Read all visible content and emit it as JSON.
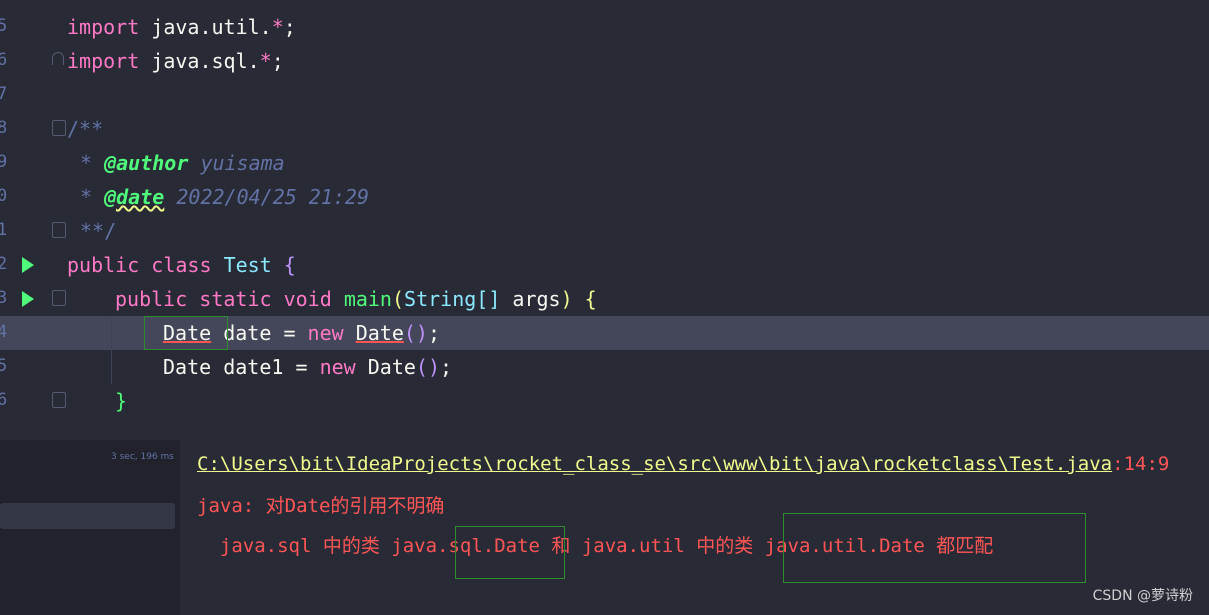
{
  "editor": {
    "lines": [
      {
        "num": "5"
      },
      {
        "num": "6"
      },
      {
        "num": "7"
      },
      {
        "num": "8"
      },
      {
        "num": "9"
      },
      {
        "num": "0"
      },
      {
        "num": "1"
      },
      {
        "num": "2"
      },
      {
        "num": "3"
      },
      {
        "num": "4"
      },
      {
        "num": "5"
      },
      {
        "num": "6"
      }
    ],
    "l1": {
      "kw": "import",
      "rest": "java.util.",
      "star": "*",
      "semi": ";"
    },
    "l2": {
      "kw": "import",
      "rest": "java.sql.",
      "star": "*",
      "semi": ";"
    },
    "l4": {
      "text": "/**"
    },
    "l5": {
      "star": "*",
      "tag": "@author",
      "val": "yuisama"
    },
    "l6": {
      "star": "*",
      "tag": "@date",
      "val": "2022/04/25 21:29"
    },
    "l7": {
      "text": "**/"
    },
    "l8": {
      "kw1": "public",
      "kw2": "class",
      "name": "Test",
      "brace": "{"
    },
    "l9": {
      "kw1": "public",
      "kw2": "static",
      "kw3": "void",
      "fn": "main",
      "lp": "(",
      "ty": "String[]",
      "arg": "args",
      "rp": ")",
      "brace": "{"
    },
    "l10": {
      "ty": "Date",
      "var": "date",
      "eq": "=",
      "kw": "new",
      "ctor": "Date",
      "parens": "()",
      "semi": ";"
    },
    "l11": {
      "ty": "Date",
      "var": "date1",
      "eq": "=",
      "kw": "new",
      "ctor": "Date",
      "parens": "()",
      "semi": ";"
    },
    "l12": {
      "brace": "}"
    }
  },
  "output": {
    "elapsed": "3 sec, 196 ms",
    "path": "C:\\Users\\bit\\IdeaProjects\\rocket_class_se\\src\\www\\bit\\java\\rocketclass\\Test.java",
    "linecol": ":14:9",
    "error": "java: 对Date的引用不明确",
    "detail": "  java.sql 中的类 java.sql.Date 和 java.util 中的类 java.util.Date 都匹配"
  },
  "watermark": "CSDN @萝诗粉",
  "colors": {
    "background": "#282a36",
    "keyword": "#ff79c6",
    "error": "#ff5555",
    "path": "#f1fa8c"
  }
}
